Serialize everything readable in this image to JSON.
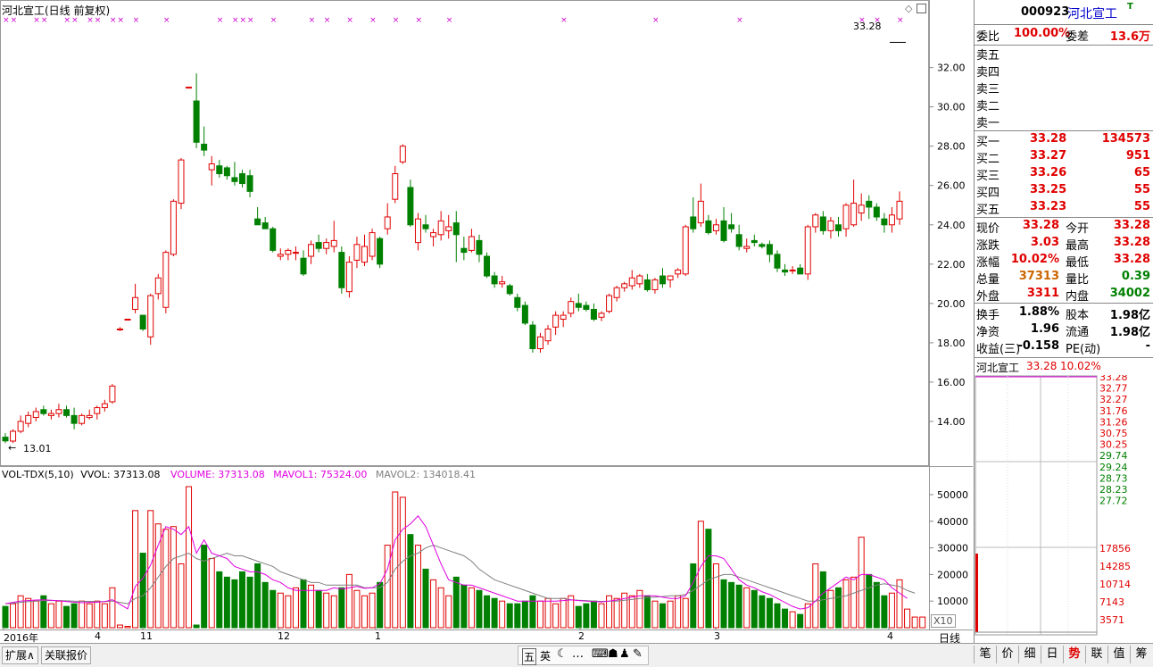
{
  "header": {
    "title": "河北宣工(日线 前复权)",
    "last_price_label": "33.28",
    "low_label": "13.01"
  },
  "price_axis": [
    "32.00",
    "30.00",
    "28.00",
    "26.00",
    "24.00",
    "22.00",
    "20.00",
    "18.00",
    "16.00",
    "14.00"
  ],
  "volume_legend": {
    "name": "VOL-TDX(5,10)",
    "vvol": "VVOL: 37313.08",
    "volume": "VOLUME: 37313.08",
    "mavol1": "MAVOL1: 75324.00",
    "mavol2": "MAVOL2: 134018.41"
  },
  "volume_axis": [
    "50000",
    "40000",
    "30000",
    "20000",
    "10000"
  ],
  "volume_unit": "X10",
  "time_axis": [
    "2016年",
    "4",
    "11",
    "12",
    "1",
    "2",
    "3",
    "4"
  ],
  "period_label": "日线",
  "colors": {
    "up": "#e00000",
    "down": "#008000",
    "ma1": "#e000e0",
    "ma2": "#808080",
    "marker": "#cc00cc"
  },
  "chart_data": {
    "type": "candlestick",
    "title": "河北宣工(日线 前复权)",
    "ylim": [
      12.5,
      33.8
    ],
    "candles": [
      [
        13.2,
        13.4,
        12.9,
        13.01
      ],
      [
        13.0,
        13.6,
        12.9,
        13.5
      ],
      [
        13.5,
        14.3,
        13.4,
        14.0
      ],
      [
        13.9,
        14.5,
        13.7,
        14.3
      ],
      [
        14.2,
        14.7,
        14.0,
        14.5
      ],
      [
        14.6,
        14.8,
        14.3,
        14.4
      ],
      [
        14.3,
        14.6,
        14.1,
        14.4
      ],
      [
        14.4,
        14.9,
        14.2,
        14.6
      ],
      [
        14.6,
        14.8,
        14.2,
        14.3
      ],
      [
        14.3,
        14.7,
        13.6,
        13.9
      ],
      [
        13.9,
        14.4,
        13.8,
        14.3
      ],
      [
        14.2,
        14.6,
        14.1,
        14.3
      ],
      [
        14.4,
        14.8,
        14.1,
        14.7
      ],
      [
        14.7,
        15.1,
        14.5,
        14.9
      ],
      [
        15.0,
        15.9,
        14.9,
        15.8
      ],
      [
        18.7,
        18.8,
        18.6,
        18.7
      ],
      [
        19.2,
        19.2,
        19.2,
        19.2
      ],
      [
        19.7,
        21.0,
        19.5,
        20.3
      ],
      [
        19.4,
        19.4,
        18.6,
        18.7
      ],
      [
        18.3,
        20.5,
        17.9,
        20.4
      ],
      [
        20.5,
        21.5,
        20.2,
        21.3
      ],
      [
        19.8,
        22.7,
        19.5,
        22.6
      ],
      [
        22.5,
        25.3,
        22.4,
        25.2
      ],
      [
        25.1,
        27.4,
        24.8,
        27.3
      ],
      [
        31.0,
        31.0,
        31.0,
        31.0
      ],
      [
        30.3,
        31.7,
        27.9,
        28.2
      ],
      [
        28.1,
        29.0,
        27.5,
        27.8
      ],
      [
        26.8,
        27.5,
        26.0,
        27.1
      ],
      [
        27.0,
        27.3,
        26.4,
        26.6
      ],
      [
        26.9,
        27.0,
        26.3,
        26.5
      ],
      [
        26.4,
        27.2,
        26.0,
        26.2
      ],
      [
        26.6,
        26.8,
        25.9,
        26.1
      ],
      [
        26.5,
        26.8,
        25.4,
        25.7
      ],
      [
        24.3,
        24.9,
        24.0,
        24.0
      ],
      [
        24.1,
        24.4,
        23.8,
        23.8
      ],
      [
        23.8,
        23.9,
        22.6,
        22.7
      ],
      [
        22.4,
        22.8,
        22.2,
        22.5
      ],
      [
        22.5,
        22.8,
        22.2,
        22.7
      ],
      [
        22.6,
        22.9,
        22.2,
        22.6
      ],
      [
        22.3,
        22.7,
        21.4,
        21.5
      ],
      [
        22.4,
        23.2,
        22.0,
        23.0
      ],
      [
        23.1,
        23.5,
        22.6,
        22.8
      ],
      [
        22.8,
        23.3,
        22.5,
        23.1
      ],
      [
        22.9,
        24.2,
        22.6,
        23.2
      ],
      [
        22.6,
        22.9,
        20.5,
        20.8
      ],
      [
        20.6,
        22.4,
        20.3,
        22.1
      ],
      [
        22.2,
        23.4,
        21.8,
        23.0
      ],
      [
        22.1,
        23.5,
        21.9,
        22.9
      ],
      [
        22.4,
        23.8,
        22.2,
        23.6
      ],
      [
        23.3,
        23.4,
        21.8,
        22.0
      ],
      [
        23.8,
        25.1,
        23.5,
        24.4
      ],
      [
        25.3,
        27.0,
        25.1,
        26.6
      ],
      [
        27.2,
        28.1,
        27.1,
        28.0
      ],
      [
        25.9,
        26.3,
        23.9,
        24.0
      ],
      [
        23.1,
        24.6,
        22.7,
        24.3
      ],
      [
        24.0,
        24.5,
        23.6,
        23.8
      ],
      [
        23.4,
        23.8,
        22.9,
        23.6
      ],
      [
        23.5,
        24.7,
        23.2,
        24.2
      ],
      [
        23.7,
        24.5,
        23.3,
        23.9
      ],
      [
        24.1,
        24.7,
        22.1,
        23.5
      ],
      [
        22.8,
        23.4,
        22.2,
        22.6
      ],
      [
        22.7,
        23.8,
        22.6,
        23.4
      ],
      [
        23.2,
        23.5,
        22.1,
        22.5
      ],
      [
        22.4,
        22.6,
        21.3,
        21.4
      ],
      [
        21.4,
        21.6,
        20.8,
        21.0
      ],
      [
        21.0,
        21.4,
        20.8,
        21.1
      ],
      [
        20.9,
        21.0,
        20.4,
        20.5
      ],
      [
        20.3,
        20.5,
        19.6,
        19.8
      ],
      [
        19.9,
        20.1,
        18.9,
        19.0
      ],
      [
        18.9,
        19.1,
        17.5,
        17.7
      ],
      [
        17.7,
        18.5,
        17.5,
        18.3
      ],
      [
        18.1,
        18.9,
        17.9,
        18.7
      ],
      [
        18.8,
        19.6,
        18.4,
        19.4
      ],
      [
        19.2,
        19.6,
        18.8,
        19.4
      ],
      [
        19.5,
        20.3,
        19.3,
        20.1
      ],
      [
        20.0,
        20.5,
        19.6,
        19.8
      ],
      [
        19.9,
        20.1,
        19.6,
        19.7
      ],
      [
        19.7,
        20.0,
        19.1,
        19.2
      ],
      [
        19.3,
        19.6,
        19.1,
        19.5
      ],
      [
        19.6,
        20.5,
        19.5,
        20.4
      ],
      [
        20.3,
        20.9,
        20.1,
        20.8
      ],
      [
        20.8,
        21.1,
        20.6,
        21.0
      ],
      [
        20.9,
        21.7,
        20.7,
        21.3
      ],
      [
        21.0,
        21.5,
        20.8,
        21.4
      ],
      [
        21.2,
        21.5,
        20.6,
        20.7
      ],
      [
        20.7,
        21.3,
        20.5,
        21.2
      ],
      [
        21.4,
        21.8,
        20.8,
        21.0
      ],
      [
        21.2,
        21.4,
        20.8,
        21.4
      ],
      [
        21.5,
        21.8,
        21.3,
        21.7
      ],
      [
        21.5,
        24.0,
        21.4,
        23.9
      ],
      [
        24.4,
        25.4,
        23.6,
        23.8
      ],
      [
        24.1,
        26.1,
        23.9,
        25.2
      ],
      [
        24.2,
        24.5,
        23.5,
        23.6
      ],
      [
        23.7,
        24.3,
        23.5,
        24.0
      ],
      [
        24.2,
        24.9,
        23.1,
        23.2
      ],
      [
        24.0,
        24.6,
        23.6,
        23.8
      ],
      [
        23.5,
        24.0,
        22.7,
        22.9
      ],
      [
        22.8,
        23.3,
        22.6,
        22.9
      ],
      [
        23.2,
        23.5,
        22.9,
        23.1
      ],
      [
        23.0,
        23.1,
        22.8,
        22.9
      ],
      [
        23.0,
        23.2,
        22.1,
        22.5
      ],
      [
        22.5,
        22.7,
        21.6,
        21.8
      ],
      [
        21.7,
        22.0,
        21.4,
        21.6
      ],
      [
        21.7,
        21.9,
        21.5,
        21.7
      ],
      [
        21.8,
        22.0,
        21.6,
        21.5
      ],
      [
        21.5,
        24.0,
        21.2,
        23.9
      ],
      [
        23.9,
        24.6,
        23.6,
        24.5
      ],
      [
        24.4,
        24.7,
        23.5,
        23.7
      ],
      [
        23.7,
        24.4,
        23.3,
        24.2
      ],
      [
        24.0,
        24.4,
        23.4,
        23.7
      ],
      [
        23.8,
        25.1,
        23.4,
        25.0
      ],
      [
        24.0,
        26.3,
        23.9,
        25.1
      ],
      [
        24.6,
        25.6,
        24.2,
        25.0
      ],
      [
        25.2,
        25.5,
        24.3,
        24.9
      ],
      [
        24.9,
        25.1,
        24.2,
        24.4
      ],
      [
        24.3,
        24.6,
        23.6,
        24.0
      ],
      [
        24.0,
        24.9,
        23.6,
        24.5
      ],
      [
        24.3,
        25.7,
        24.0,
        25.2
      ]
    ],
    "limit_up_marks": [
      [
        132.5,
        33.28
      ],
      [
        143,
        33.28
      ],
      [
        145,
        33.28
      ]
    ],
    "volumes": [
      8,
      9,
      12,
      11,
      10,
      12,
      9,
      10,
      8,
      9,
      10,
      9,
      10,
      9,
      15,
      1,
      0.5,
      44,
      28,
      44,
      39,
      37,
      38,
      24,
      53,
      1,
      31,
      26,
      21,
      19,
      18,
      21,
      19,
      24,
      17,
      14,
      13,
      12,
      15,
      18,
      16,
      14,
      13,
      12,
      15,
      20,
      14,
      12,
      13,
      17,
      31,
      51,
      49,
      35,
      31,
      22,
      18,
      15,
      12,
      19,
      16,
      15,
      14,
      12,
      11,
      10,
      9,
      9,
      10,
      12,
      10,
      11,
      9,
      11,
      12,
      8,
      9,
      10,
      9,
      12,
      11,
      13,
      12,
      14,
      12,
      10,
      9,
      10,
      12,
      11,
      24,
      40,
      37,
      24,
      18,
      17,
      16,
      15,
      14,
      12,
      11,
      9,
      7,
      6,
      5,
      9,
      24,
      21,
      14,
      15,
      18,
      19,
      34,
      20,
      17,
      12,
      13,
      18,
      7,
      4,
      4
    ],
    "mavol1": [
      9,
      9.5,
      10,
      10.2,
      10.4,
      10.5,
      10.3,
      10.1,
      9.8,
      9.6,
      9.4,
      9.5,
      9.6,
      9.8,
      10.5,
      8.8,
      7.1,
      15.5,
      18.6,
      23.5,
      31,
      38,
      37,
      35,
      38,
      28,
      33,
      28,
      27,
      26,
      23,
      22,
      21,
      21,
      20,
      18,
      17,
      15,
      14,
      14,
      14,
      14,
      14,
      15,
      14.5,
      15,
      15.5,
      14.8,
      15,
      16.5,
      22,
      33,
      37,
      39,
      42,
      38,
      31,
      24,
      18,
      17,
      16,
      16,
      15,
      14,
      13,
      12,
      11,
      10,
      10,
      10,
      10,
      10,
      10,
      10.2,
      10.5,
      10.2,
      10,
      9.8,
      9.7,
      10,
      10.4,
      11,
      11.5,
      12,
      12,
      12,
      11.5,
      11,
      11,
      12,
      17,
      23,
      27,
      27,
      26,
      22,
      18,
      16,
      15,
      13.5,
      12.5,
      11,
      9.5,
      8,
      7,
      7.5,
      10,
      13,
      15,
      17,
      19,
      18,
      20,
      20,
      19,
      18,
      15,
      13,
      11
    ],
    "mavol2": [
      9,
      9.2,
      9.5,
      9.8,
      10,
      10.2,
      10.2,
      10.2,
      10.1,
      10,
      9.9,
      9.9,
      9.8,
      9.8,
      10,
      9.5,
      9,
      11,
      12,
      15,
      19,
      23,
      26,
      27,
      28,
      26,
      25,
      26,
      27,
      28,
      27,
      27,
      26,
      25,
      24,
      23,
      21,
      20,
      19,
      18,
      17,
      17,
      16,
      16,
      16,
      16,
      16,
      15,
      15,
      15,
      17,
      22,
      25,
      27,
      28,
      30,
      31,
      30,
      29,
      28,
      27,
      25,
      22,
      20,
      18,
      17,
      16,
      15,
      14,
      13,
      12,
      11,
      11,
      11,
      10.5,
      10.3,
      10.2,
      10,
      9.9,
      10,
      10,
      10.3,
      10.6,
      11,
      11.3,
      11.5,
      11.7,
      12,
      12,
      12.5,
      14,
      16,
      18,
      19,
      20,
      20,
      19,
      18,
      17,
      16,
      15,
      14,
      13,
      12,
      11,
      10,
      10,
      10.5,
      11,
      11.5,
      12,
      13,
      14,
      15,
      16,
      16.5,
      16,
      15.5,
      14,
      13
    ]
  },
  "panel": {
    "code": "000923",
    "name": "河北宣工",
    "flag": "T",
    "weibi_label": "委比",
    "weibi": "100.00%",
    "weicha_label": "委差",
    "weicha": "13.6万",
    "sell": [
      {
        "label": "卖五",
        "price": "",
        "vol": ""
      },
      {
        "label": "卖四",
        "price": "",
        "vol": ""
      },
      {
        "label": "卖三",
        "price": "",
        "vol": ""
      },
      {
        "label": "卖二",
        "price": "",
        "vol": ""
      },
      {
        "label": "卖一",
        "price": "",
        "vol": ""
      }
    ],
    "buy": [
      {
        "label": "买一",
        "price": "33.28",
        "vol": "134573"
      },
      {
        "label": "买二",
        "price": "33.27",
        "vol": "951"
      },
      {
        "label": "买三",
        "price": "33.26",
        "vol": "65"
      },
      {
        "label": "买四",
        "price": "33.25",
        "vol": "55"
      },
      {
        "label": "买五",
        "price": "33.23",
        "vol": "55"
      }
    ],
    "quote": [
      {
        "l1": "现价",
        "v1": "33.28",
        "c1": "red",
        "l2": "今开",
        "v2": "33.28",
        "c2": "red"
      },
      {
        "l1": "涨跌",
        "v1": "3.03",
        "c1": "red",
        "l2": "最高",
        "v2": "33.28",
        "c2": "red"
      },
      {
        "l1": "涨幅",
        "v1": "10.02%",
        "c1": "red",
        "l2": "最低",
        "v2": "33.28",
        "c2": "red"
      },
      {
        "l1": "总量",
        "v1": "37313",
        "c1": "orange",
        "l2": "量比",
        "v2": "0.39",
        "c2": "green"
      },
      {
        "l1": "外盘",
        "v1": "3311",
        "c1": "red",
        "l2": "内盘",
        "v2": "34002",
        "c2": "green"
      }
    ],
    "finance": [
      {
        "l1": "换手",
        "v1": "1.88%",
        "l2": "股本",
        "v2": "1.98亿"
      },
      {
        "l1": "净资",
        "v1": "1.96",
        "l2": "流通",
        "v2": "1.98亿"
      },
      {
        "l1": "收益(三)",
        "v1": "-0.158",
        "l2": "PE(动)",
        "v2": "-"
      }
    ],
    "mini_title": "河北宣工",
    "mini_price": "33.28",
    "mini_pct": "10.02%",
    "mini_prices": [
      "33.28",
      "32.77",
      "32.27",
      "31.76",
      "31.26",
      "30.75",
      "30.25",
      "29.74",
      "29.24",
      "28.73",
      "28.23",
      "27.72"
    ],
    "mini_vols": [
      "17856",
      "14285",
      "10714",
      "7143",
      "3571"
    ]
  },
  "bottom": {
    "tabs": [
      "扩展∧",
      "关联报价"
    ],
    "tools": [
      "五",
      "英",
      "☾",
      "…",
      "⌨",
      "☗",
      "♟",
      "✎"
    ],
    "right_tabs": [
      "笔",
      "价",
      "细",
      "日",
      "势",
      "联",
      "值",
      "筹"
    ]
  }
}
